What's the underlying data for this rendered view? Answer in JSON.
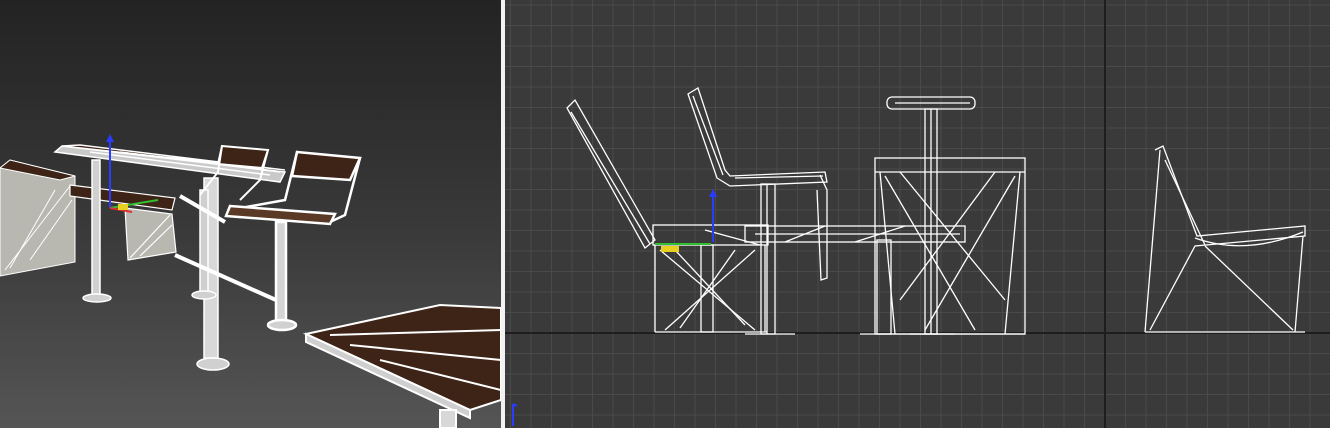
{
  "viewports": [
    {
      "id": "perspective",
      "active": false
    },
    {
      "id": "front",
      "active": true,
      "grid": true
    }
  ],
  "colors": {
    "grid_minor": "#4a4a4a",
    "grid_major": "#232323",
    "wire": "#ffffff",
    "wood": "#3d2416",
    "gizmo_x": "#e03030",
    "gizmo_y": "#30c030",
    "gizmo_z": "#2a3cff"
  }
}
